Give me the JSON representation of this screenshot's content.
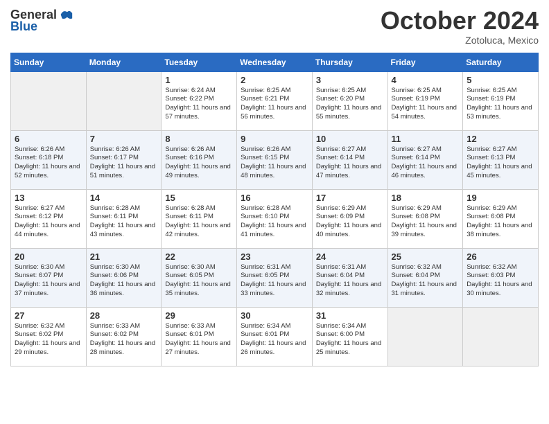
{
  "header": {
    "logo_general": "General",
    "logo_blue": "Blue",
    "month": "October 2024",
    "location": "Zotoluca, Mexico"
  },
  "weekdays": [
    "Sunday",
    "Monday",
    "Tuesday",
    "Wednesday",
    "Thursday",
    "Friday",
    "Saturday"
  ],
  "weeks": [
    [
      {
        "day": "",
        "content": ""
      },
      {
        "day": "",
        "content": ""
      },
      {
        "day": "1",
        "content": "Sunrise: 6:24 AM\nSunset: 6:22 PM\nDaylight: 11 hours and 57 minutes."
      },
      {
        "day": "2",
        "content": "Sunrise: 6:25 AM\nSunset: 6:21 PM\nDaylight: 11 hours and 56 minutes."
      },
      {
        "day": "3",
        "content": "Sunrise: 6:25 AM\nSunset: 6:20 PM\nDaylight: 11 hours and 55 minutes."
      },
      {
        "day": "4",
        "content": "Sunrise: 6:25 AM\nSunset: 6:19 PM\nDaylight: 11 hours and 54 minutes."
      },
      {
        "day": "5",
        "content": "Sunrise: 6:25 AM\nSunset: 6:19 PM\nDaylight: 11 hours and 53 minutes."
      }
    ],
    [
      {
        "day": "6",
        "content": "Sunrise: 6:26 AM\nSunset: 6:18 PM\nDaylight: 11 hours and 52 minutes."
      },
      {
        "day": "7",
        "content": "Sunrise: 6:26 AM\nSunset: 6:17 PM\nDaylight: 11 hours and 51 minutes."
      },
      {
        "day": "8",
        "content": "Sunrise: 6:26 AM\nSunset: 6:16 PM\nDaylight: 11 hours and 49 minutes."
      },
      {
        "day": "9",
        "content": "Sunrise: 6:26 AM\nSunset: 6:15 PM\nDaylight: 11 hours and 48 minutes."
      },
      {
        "day": "10",
        "content": "Sunrise: 6:27 AM\nSunset: 6:14 PM\nDaylight: 11 hours and 47 minutes."
      },
      {
        "day": "11",
        "content": "Sunrise: 6:27 AM\nSunset: 6:14 PM\nDaylight: 11 hours and 46 minutes."
      },
      {
        "day": "12",
        "content": "Sunrise: 6:27 AM\nSunset: 6:13 PM\nDaylight: 11 hours and 45 minutes."
      }
    ],
    [
      {
        "day": "13",
        "content": "Sunrise: 6:27 AM\nSunset: 6:12 PM\nDaylight: 11 hours and 44 minutes."
      },
      {
        "day": "14",
        "content": "Sunrise: 6:28 AM\nSunset: 6:11 PM\nDaylight: 11 hours and 43 minutes."
      },
      {
        "day": "15",
        "content": "Sunrise: 6:28 AM\nSunset: 6:11 PM\nDaylight: 11 hours and 42 minutes."
      },
      {
        "day": "16",
        "content": "Sunrise: 6:28 AM\nSunset: 6:10 PM\nDaylight: 11 hours and 41 minutes."
      },
      {
        "day": "17",
        "content": "Sunrise: 6:29 AM\nSunset: 6:09 PM\nDaylight: 11 hours and 40 minutes."
      },
      {
        "day": "18",
        "content": "Sunrise: 6:29 AM\nSunset: 6:08 PM\nDaylight: 11 hours and 39 minutes."
      },
      {
        "day": "19",
        "content": "Sunrise: 6:29 AM\nSunset: 6:08 PM\nDaylight: 11 hours and 38 minutes."
      }
    ],
    [
      {
        "day": "20",
        "content": "Sunrise: 6:30 AM\nSunset: 6:07 PM\nDaylight: 11 hours and 37 minutes."
      },
      {
        "day": "21",
        "content": "Sunrise: 6:30 AM\nSunset: 6:06 PM\nDaylight: 11 hours and 36 minutes."
      },
      {
        "day": "22",
        "content": "Sunrise: 6:30 AM\nSunset: 6:05 PM\nDaylight: 11 hours and 35 minutes."
      },
      {
        "day": "23",
        "content": "Sunrise: 6:31 AM\nSunset: 6:05 PM\nDaylight: 11 hours and 33 minutes."
      },
      {
        "day": "24",
        "content": "Sunrise: 6:31 AM\nSunset: 6:04 PM\nDaylight: 11 hours and 32 minutes."
      },
      {
        "day": "25",
        "content": "Sunrise: 6:32 AM\nSunset: 6:04 PM\nDaylight: 11 hours and 31 minutes."
      },
      {
        "day": "26",
        "content": "Sunrise: 6:32 AM\nSunset: 6:03 PM\nDaylight: 11 hours and 30 minutes."
      }
    ],
    [
      {
        "day": "27",
        "content": "Sunrise: 6:32 AM\nSunset: 6:02 PM\nDaylight: 11 hours and 29 minutes."
      },
      {
        "day": "28",
        "content": "Sunrise: 6:33 AM\nSunset: 6:02 PM\nDaylight: 11 hours and 28 minutes."
      },
      {
        "day": "29",
        "content": "Sunrise: 6:33 AM\nSunset: 6:01 PM\nDaylight: 11 hours and 27 minutes."
      },
      {
        "day": "30",
        "content": "Sunrise: 6:34 AM\nSunset: 6:01 PM\nDaylight: 11 hours and 26 minutes."
      },
      {
        "day": "31",
        "content": "Sunrise: 6:34 AM\nSunset: 6:00 PM\nDaylight: 11 hours and 25 minutes."
      },
      {
        "day": "",
        "content": ""
      },
      {
        "day": "",
        "content": ""
      }
    ]
  ]
}
